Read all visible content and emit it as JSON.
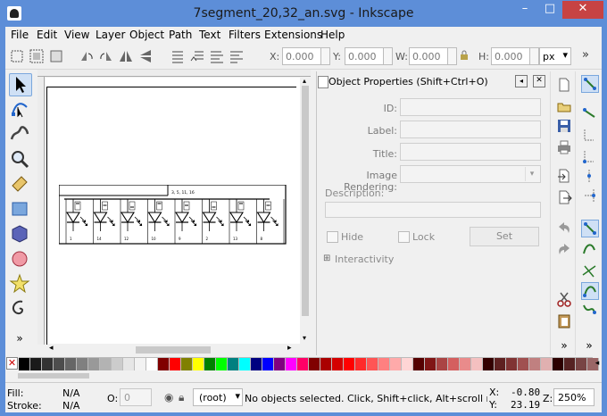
{
  "window": {
    "title": "7segment_20,32_an.svg - Inkscape",
    "minimize": "–",
    "maximize": "□",
    "close": "✕"
  },
  "menu": [
    {
      "label": "File"
    },
    {
      "label": "Edit"
    },
    {
      "label": "View"
    },
    {
      "label": "Layer"
    },
    {
      "label": "Object"
    },
    {
      "label": "Path"
    },
    {
      "label": "Text"
    },
    {
      "label": "Filters"
    },
    {
      "label": "Extensions"
    },
    {
      "label": "Help"
    }
  ],
  "toolbar": {
    "x_label": "X:",
    "x_value": "0.000",
    "y_label": "Y:",
    "y_value": "0.000",
    "w_label": "W:",
    "w_value": "0.000",
    "h_label": "H:",
    "h_value": "0.000",
    "unit": "px",
    "overflow": "»"
  },
  "drawing": {
    "top_label": "3, 5, 11, 16",
    "pin_labels": [
      "1",
      "14",
      "12",
      "10",
      "9",
      "2",
      "13",
      "8"
    ]
  },
  "object_properties": {
    "title": "Object Properties (Shift+Ctrl+O)",
    "id_label": "ID:",
    "label_label": "Label:",
    "title_label": "Title:",
    "image_rendering_label": "Image Rendering:",
    "description_label": "Description:",
    "hide_label": "Hide",
    "lock_label": "Lock",
    "set_button": "Set",
    "interactivity_label": "Interactivity",
    "expander": "⊞"
  },
  "status": {
    "fill_label": "Fill:",
    "fill_value": "N/A",
    "stroke_label": "Stroke:",
    "stroke_value": "N/A",
    "opacity_label": "O:",
    "opacity_value": "0",
    "layer": "(root)",
    "message": "No objects selected. Click, Shift+click, Alt+scroll mouse ...",
    "x_label": "X:",
    "x_value": "-0.80",
    "y_label": "Y:",
    "y_value": "23.19",
    "zoom_label": "Z:",
    "zoom_value": "250%"
  },
  "palette": [
    "#000000",
    "#1a1a1a",
    "#333333",
    "#4d4d4d",
    "#666666",
    "#808080",
    "#999999",
    "#b3b3b3",
    "#cccccc",
    "#e6e6e6",
    "#f2f2f2",
    "#ffffff",
    "#800000",
    "#ff0000",
    "#808000",
    "#ffff00",
    "#008000",
    "#00ff00",
    "#008080",
    "#00ffff",
    "#000080",
    "#0000ff",
    "#800080",
    "#ff00ff",
    "#ff0066",
    "#800000",
    "#aa0000",
    "#d40000",
    "#ff0000",
    "#ff2a2a",
    "#ff5555",
    "#ff8080",
    "#ffaaaa",
    "#ffd5d5",
    "#550000",
    "#801515",
    "#aa4444",
    "#d45f5f",
    "#e98b8b",
    "#f4c0c0",
    "#330000",
    "#5e2020",
    "#803333",
    "#a05050",
    "#c08080",
    "#e0b0b0",
    "#2b0000",
    "#552222",
    "#784444",
    "#9a6666"
  ]
}
